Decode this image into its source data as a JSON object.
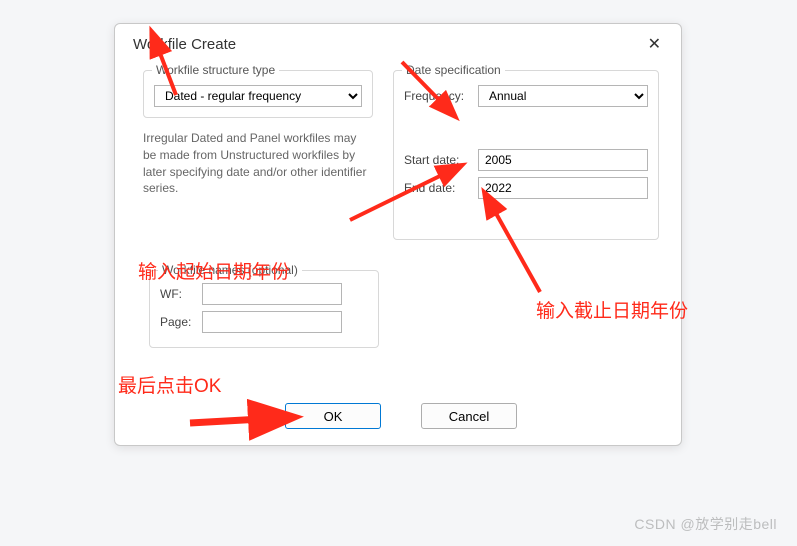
{
  "dialog": {
    "title": "Workfile Create",
    "close_icon_label": "✕"
  },
  "structure": {
    "legend": "Workfile structure type",
    "selected": "Dated - regular frequency",
    "helper_text": "Irregular Dated and Panel workfiles may be made from Unstructured workfiles by later specifying date and/or other identifier series."
  },
  "date_spec": {
    "legend": "Date specification",
    "frequency_label": "Frequency:",
    "frequency_value": "Annual",
    "start_label": "Start date:",
    "start_value": "2005",
    "end_label": "End date:",
    "end_value": "2022"
  },
  "names": {
    "legend": "Workfile names (optional)",
    "wf_label": "WF:",
    "wf_value": "",
    "page_label": "Page:",
    "page_value": ""
  },
  "buttons": {
    "ok": "OK",
    "cancel": "Cancel"
  },
  "annotations": {
    "start_year": "输入起始日期年份",
    "end_year": "输入截止日期年份",
    "click_ok": "最后点击OK"
  },
  "watermark": "CSDN @放学别走bell"
}
